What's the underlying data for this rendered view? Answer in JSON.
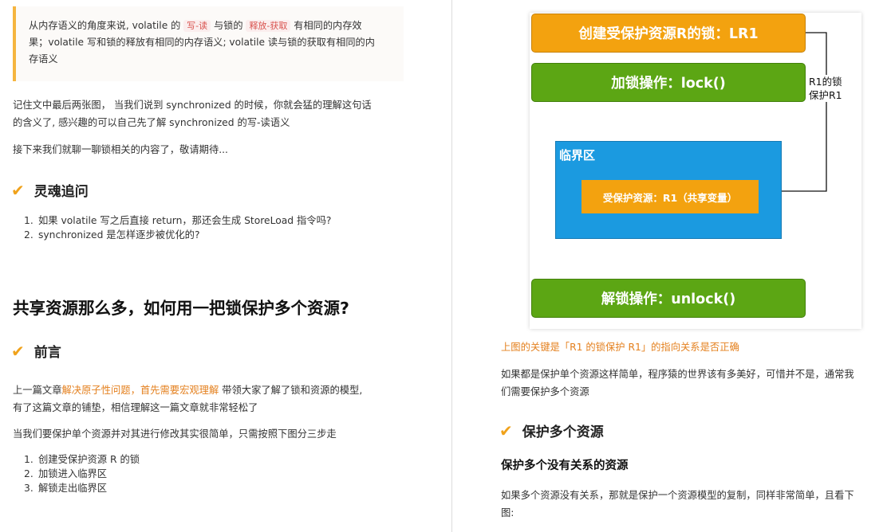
{
  "left": {
    "quote": {
      "line1_prefix": "从内存语义的角度来说, volatile 的",
      "tag_write_read": "写-读",
      "line1_mid": "与锁的",
      "tag_release_acquire": "释放-获取",
      "line1_suffix": "有相同的内存效",
      "line2": "果；volatile 写和锁的释放有相同的内存语义; volatile 读与锁的获取有相同的内",
      "line3": "存语义"
    },
    "para1_line1": "记住文中最后两张图， 当我们说到 synchronized 的时候，你就会猛的理解这句话",
    "para1_line2": "的含义了, 感兴趣的可以自己先了解 synchronized 的写-读语义",
    "para2": "接下来我们就聊一聊锁相关的内容了，敬请期待...",
    "h_soul": "灵魂追问",
    "soul_items": [
      {
        "num": "1.",
        "text": "如果 volatile 写之后直接 return，那还会生成 StoreLoad 指令吗?"
      },
      {
        "num": "2.",
        "text": "synchronized 是怎样逐步被优化的?"
      }
    ],
    "h2_title": "共享资源那么多，如何用一把锁保护多个资源?",
    "h_preface": "前言",
    "para3_prefix": "上一篇文章",
    "para3_link": "解决原子性问题，首先需要宏观理解",
    "para3_suffix": "带领大家了解了锁和资源的模型,",
    "para3_line2": "有了这篇文章的铺垫，相信理解这一篇文章就非常轻松了",
    "para4": "当我们要保护单个资源并对其进行修改其实很简单，只需按照下图分三步走",
    "steps": [
      {
        "num": "1.",
        "text": "创建受保护资源 R 的锁"
      },
      {
        "num": "2.",
        "text": "加锁进入临界区"
      },
      {
        "num": "3.",
        "text": "解锁走出临界区"
      }
    ]
  },
  "diagram": {
    "create_lock": "创建受保护资源R的锁：LR1",
    "lock_op": "加锁操作：lock()",
    "side_note_line1": "R1的锁",
    "side_note_line2": "保护R1",
    "critical_section": "临界区",
    "protected_resource": "受保护资源：R1（共享变量）",
    "unlock_op": "解锁操作：unlock()",
    "colors": {
      "orange": "#f3a20f",
      "green": "#5ca614",
      "blue": "#1b9ae0"
    }
  },
  "right": {
    "caption": "上图的关键是「R1 的锁保护 R1」的指向关系是否正确",
    "para1_line1": "如果都是保护单个资源这样简单，程序猿的世界该有多美好，可惜并不是，通常我",
    "para1_line2": "们需要保护多个资源",
    "h_protect_multi": "保护多个资源",
    "h4_unrelated": "保护多个没有关系的资源",
    "para2_line1": "如果多个资源没有关系，那就是保护一个资源模型的复制，同样非常简单，且看下",
    "para2_line2": "图:"
  }
}
